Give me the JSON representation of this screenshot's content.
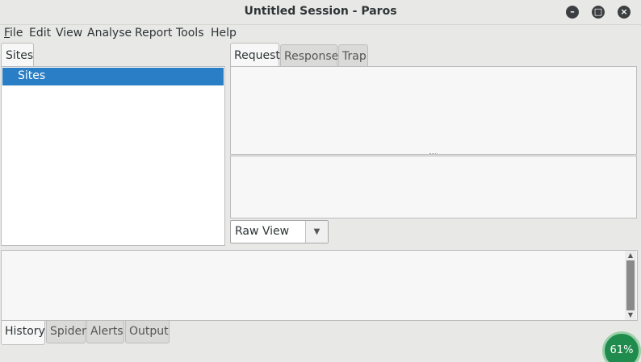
{
  "window": {
    "title": "Untitled Session - Paros",
    "minimize_icon": "minimize-icon",
    "maximize_icon": "maximize-icon",
    "close_icon": "close-icon"
  },
  "menu": {
    "items": [
      {
        "mnemonic": "F",
        "rest": "ile"
      },
      {
        "mnemonic": "",
        "rest": "Edit"
      },
      {
        "mnemonic": "",
        "rest": "View"
      },
      {
        "mnemonic": "",
        "rest": "Analyse"
      },
      {
        "mnemonic": "",
        "rest": "Report"
      },
      {
        "mnemonic": "",
        "rest": "Tools"
      },
      {
        "mnemonic": "",
        "rest": "Help"
      }
    ]
  },
  "sites": {
    "tab_label": "Sites",
    "tree_root": "Sites"
  },
  "detail_tabs": [
    {
      "label": "Request",
      "active": true
    },
    {
      "label": "Response",
      "active": false
    },
    {
      "label": "Trap",
      "active": false
    }
  ],
  "view_select": {
    "value": "Raw View",
    "arrow_icon": "chevron-down-icon"
  },
  "bottom_tabs": [
    {
      "label": "History",
      "active": true
    },
    {
      "label": "Spider",
      "active": false
    },
    {
      "label": "Alerts",
      "active": false
    },
    {
      "label": "Output",
      "active": false
    }
  ],
  "indicator": {
    "value": "61%"
  }
}
